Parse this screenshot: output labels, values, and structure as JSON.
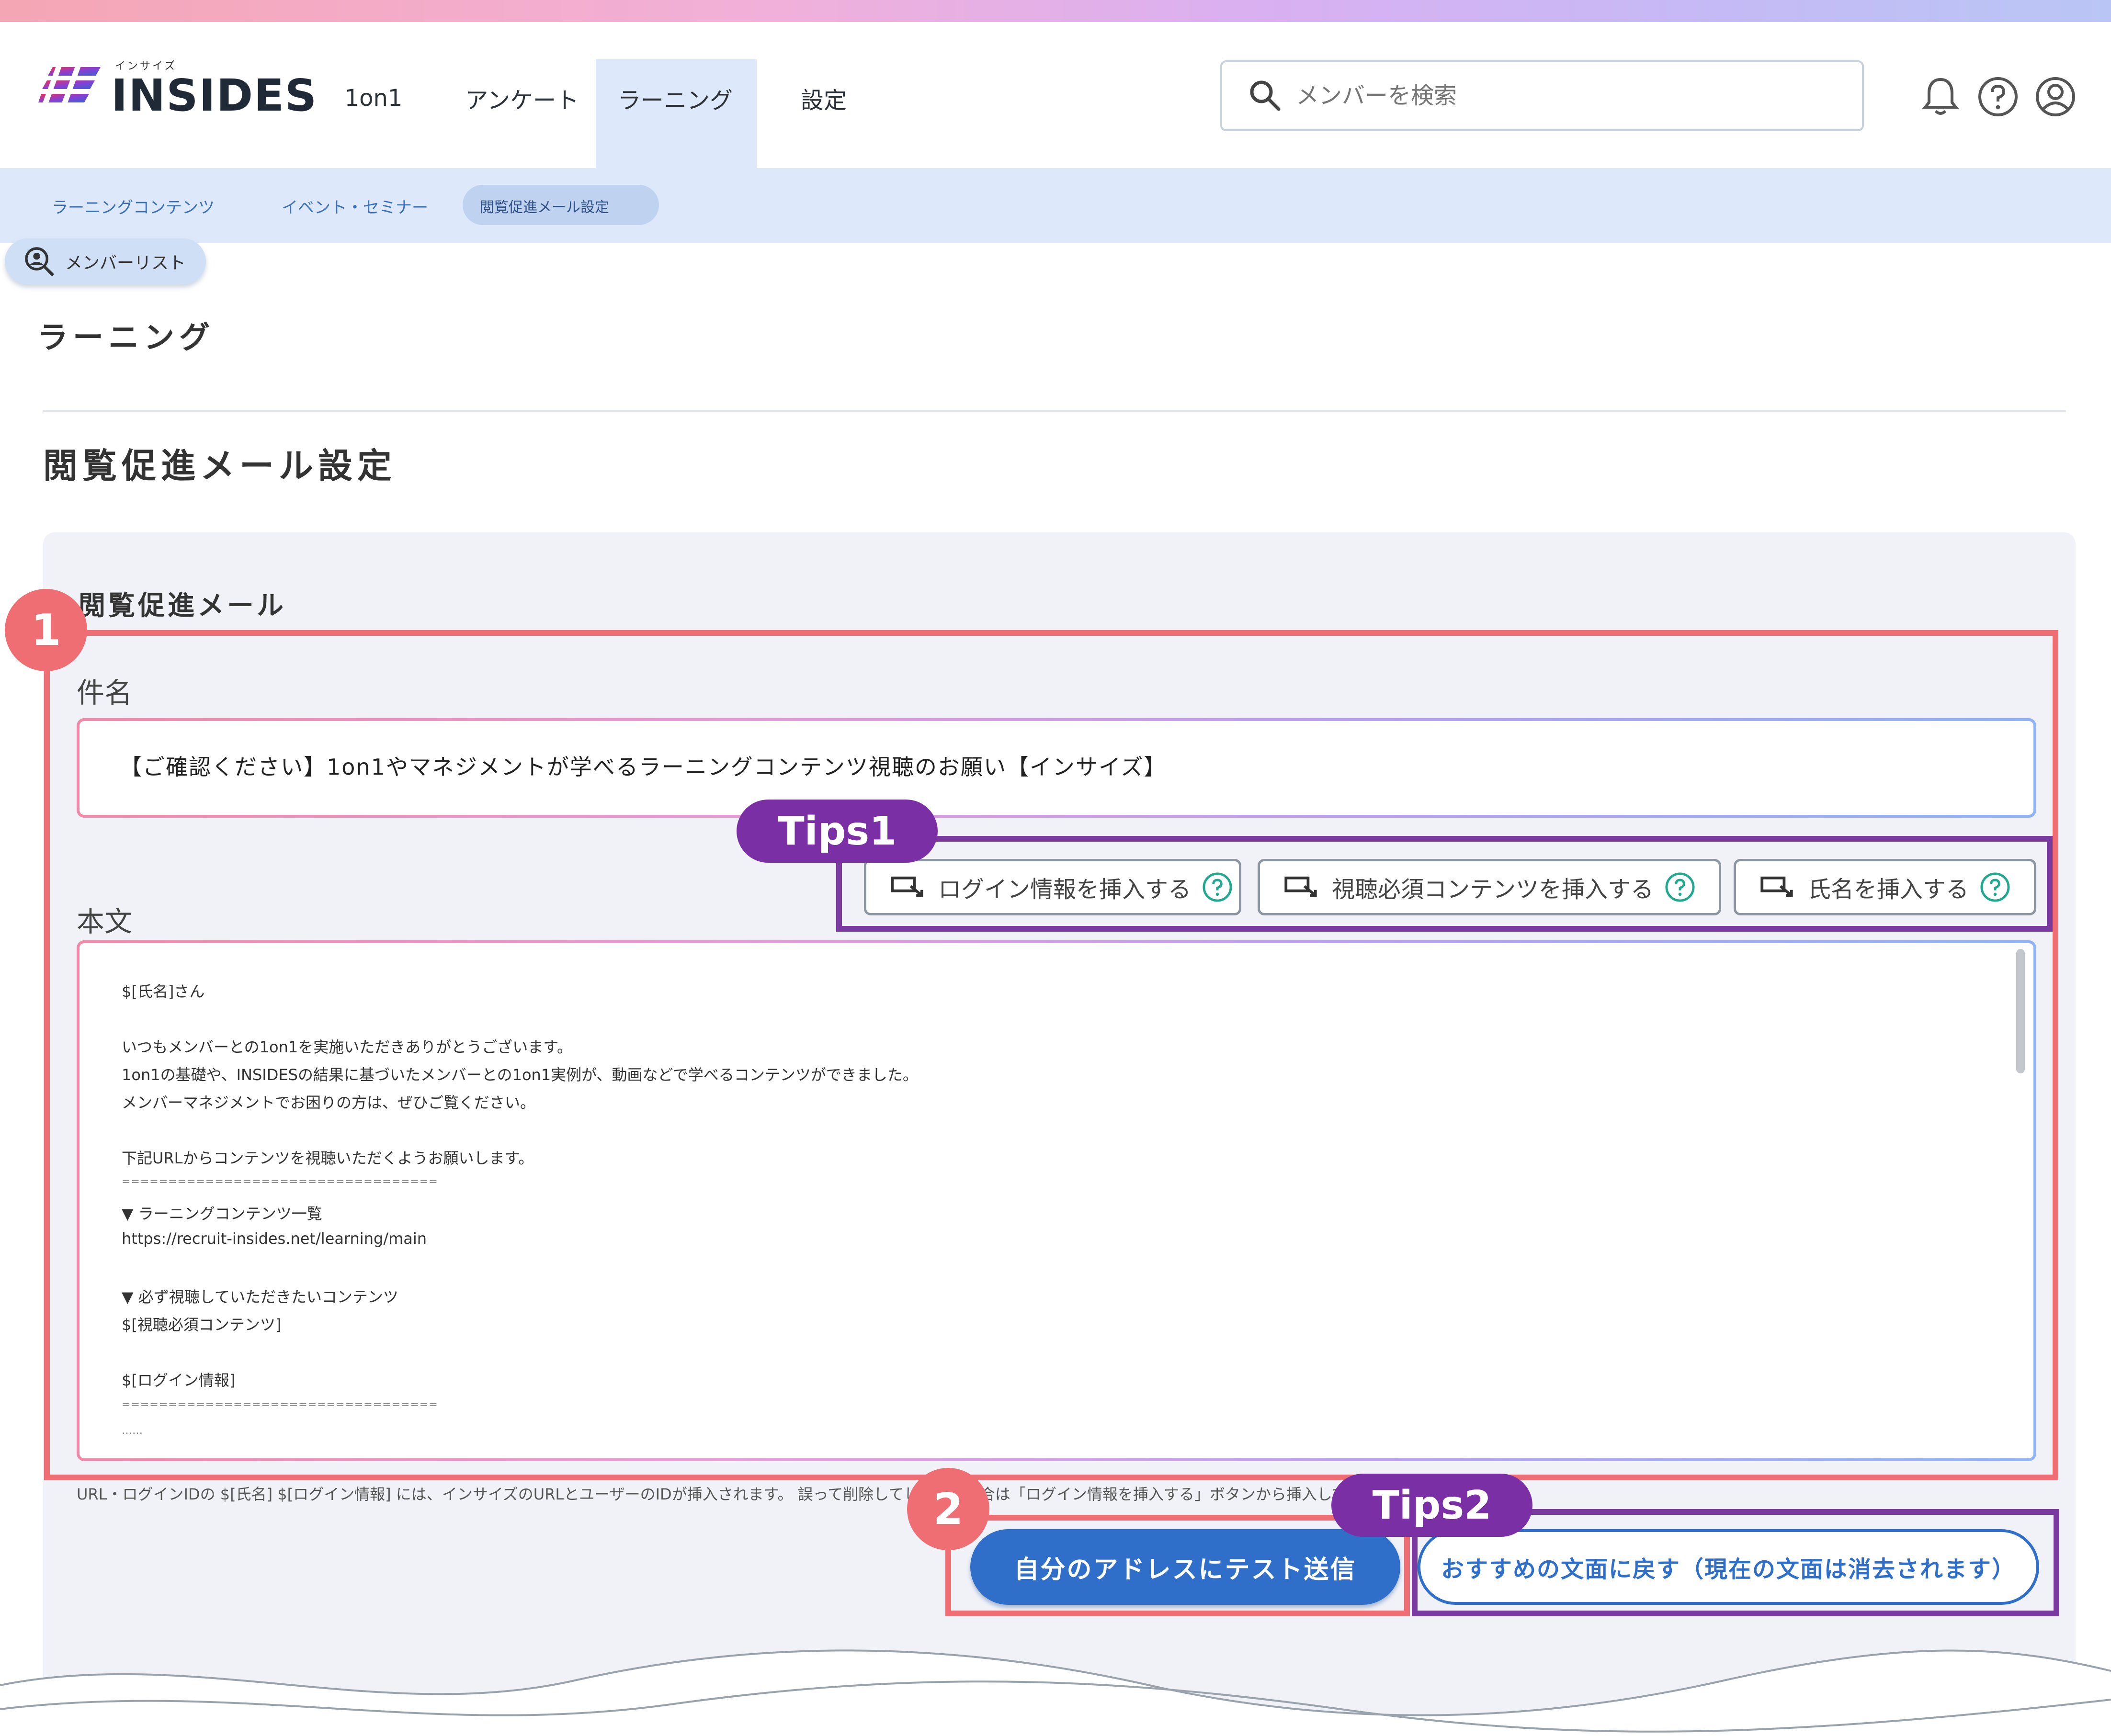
{
  "header": {
    "logo_text": "INSIDES",
    "logo_sub": "インサイズ",
    "nav": [
      "1on1",
      "アンケート",
      "ラーニング",
      "設定"
    ],
    "active_nav": "ラーニング",
    "search_placeholder": "メンバーを検索"
  },
  "subnav": {
    "items": [
      "ラーニングコンテンツ",
      "イベント・セミナー",
      "閲覧促進メール設定"
    ],
    "active": "閲覧促進メール設定",
    "member_list": "メンバーリスト"
  },
  "page": {
    "title": "ラーニング",
    "section_title": "閲覧促進メール設定"
  },
  "form": {
    "panel_title": "閲覧促進メール",
    "subject_label": "件名",
    "subject_value": "【ご確認ください】1on1やマネジメントが学べるラーニングコンテンツ視聴のお願い【インサイズ】",
    "body_label": "本文",
    "insert_buttons": [
      "ログイン情報を挿入する",
      "視聴必須コンテンツを挿入する",
      "氏名を挿入する"
    ],
    "body_lines": [
      "$[氏名]さん",
      "",
      "いつもメンバーとの1on1を実施いただきありがとうございます。",
      "1on1の基礎や、INSIDESの結果に基づいたメンバーとの1on1実例が、動画などで学べるコンテンツができました。",
      "メンバーマネジメントでお困りの方は、ぜひご覧ください。",
      "",
      "下記URLからコンテンツを視聴いただくようお願いします。",
      "==================================",
      "▼ ラーニングコンテンツ一覧",
      "https://recruit-insides.net/learning/main",
      "",
      "▼ 必ず視聴していただきたいコンテンツ",
      "$[視聴必須コンテンツ]",
      "",
      "$[ログイン情報]",
      "==================================",
      "……"
    ],
    "note": "URL・ログインIDの $[氏名] $[ログイン情報] には、インサイズのURLとユーザーのIDが挿入されます。 誤って削除してしまった場合は「ログイン情報を挿入する」ボタンから挿入してください。",
    "test_button": "自分のアドレスにテスト送信",
    "reset_button": "おすすめの文面に戻す（現在の文面は消去されます）"
  },
  "annotations": {
    "badge1": "1",
    "badge2": "2",
    "tips1": "Tips1",
    "tips2": "Tips2"
  },
  "colors": {
    "accent_blue": "#2f6fc9",
    "annotation_red": "#ee6e73",
    "annotation_purple": "#7b2fa5",
    "nav_highlight": "#dde9fb"
  }
}
